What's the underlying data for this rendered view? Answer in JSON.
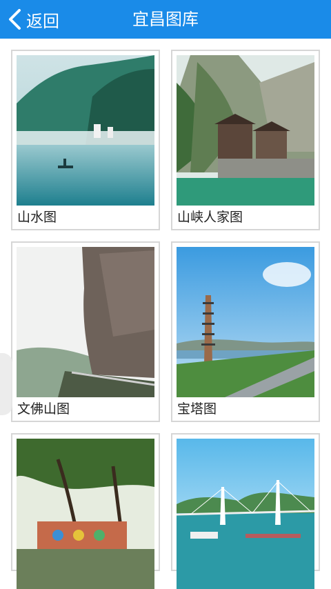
{
  "header": {
    "back_label": "返回",
    "title": "宜昌图库"
  },
  "gallery": [
    {
      "label": "山水图"
    },
    {
      "label": "山峡人家图"
    },
    {
      "label": "文佛山图"
    },
    {
      "label": "宝塔图"
    },
    {
      "label": ""
    },
    {
      "label": ""
    }
  ],
  "colors": {
    "header": "#1a8be8",
    "card_border": "#d6d6d6"
  }
}
